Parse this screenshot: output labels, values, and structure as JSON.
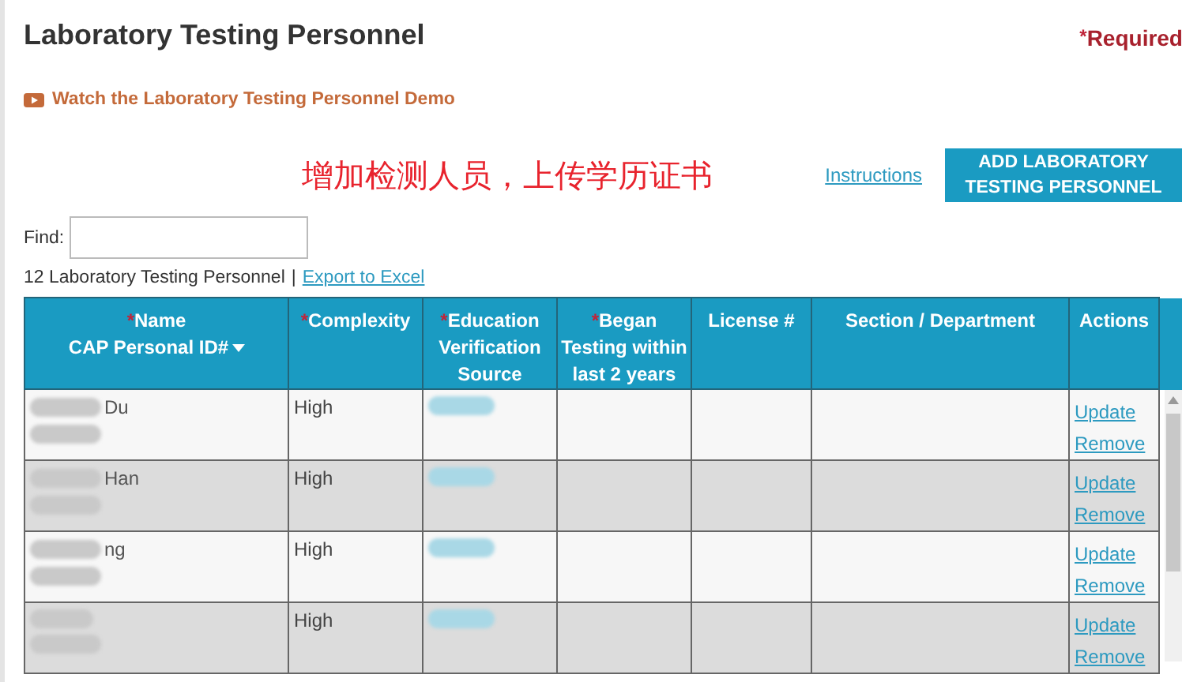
{
  "page": {
    "title": "Laboratory Testing Personnel",
    "required_mark": "*",
    "required_note": "Required",
    "demo_link": "Watch the Laboratory Testing Personnel Demo",
    "annotation": "增加检测人员，上传学历证书",
    "instructions_link": "Instructions",
    "add_button": [
      "ADD LABORATORY",
      "TESTING PERSONNEL"
    ]
  },
  "find": {
    "label": "Find:"
  },
  "summary": {
    "count": "12 Laboratory Testing Personnel",
    "separator": "|",
    "export_link": "Export to Excel"
  },
  "table": {
    "columns": [
      {
        "lines": [
          "Name",
          "CAP Personal ID#"
        ],
        "required": true,
        "sortable": true
      },
      {
        "lines": [
          "Complexity"
        ],
        "required": true,
        "sortable": false
      },
      {
        "lines": [
          "Education",
          "Verification",
          "Source"
        ],
        "required": true,
        "sortable": false
      },
      {
        "lines": [
          "Began",
          "Testing within",
          "last 2 years"
        ],
        "required": true,
        "sortable": false
      },
      {
        "lines": [
          "License #"
        ],
        "required": false,
        "sortable": false
      },
      {
        "lines": [
          "Section / Department"
        ],
        "required": false,
        "sortable": false
      },
      {
        "lines": [
          "Actions"
        ],
        "required": false,
        "sortable": false
      }
    ],
    "rows": [
      {
        "name_fragment": "Du",
        "complexity": "High",
        "actions": [
          "Update",
          "Remove"
        ]
      },
      {
        "name_fragment": "Han",
        "complexity": "High",
        "actions": [
          "Update",
          "Remove"
        ]
      },
      {
        "name_fragment": "ng",
        "complexity": "High",
        "actions": [
          "Update",
          "Remove"
        ]
      },
      {
        "complexity": "High",
        "actions": [
          "Update",
          "Remove"
        ]
      }
    ]
  }
}
